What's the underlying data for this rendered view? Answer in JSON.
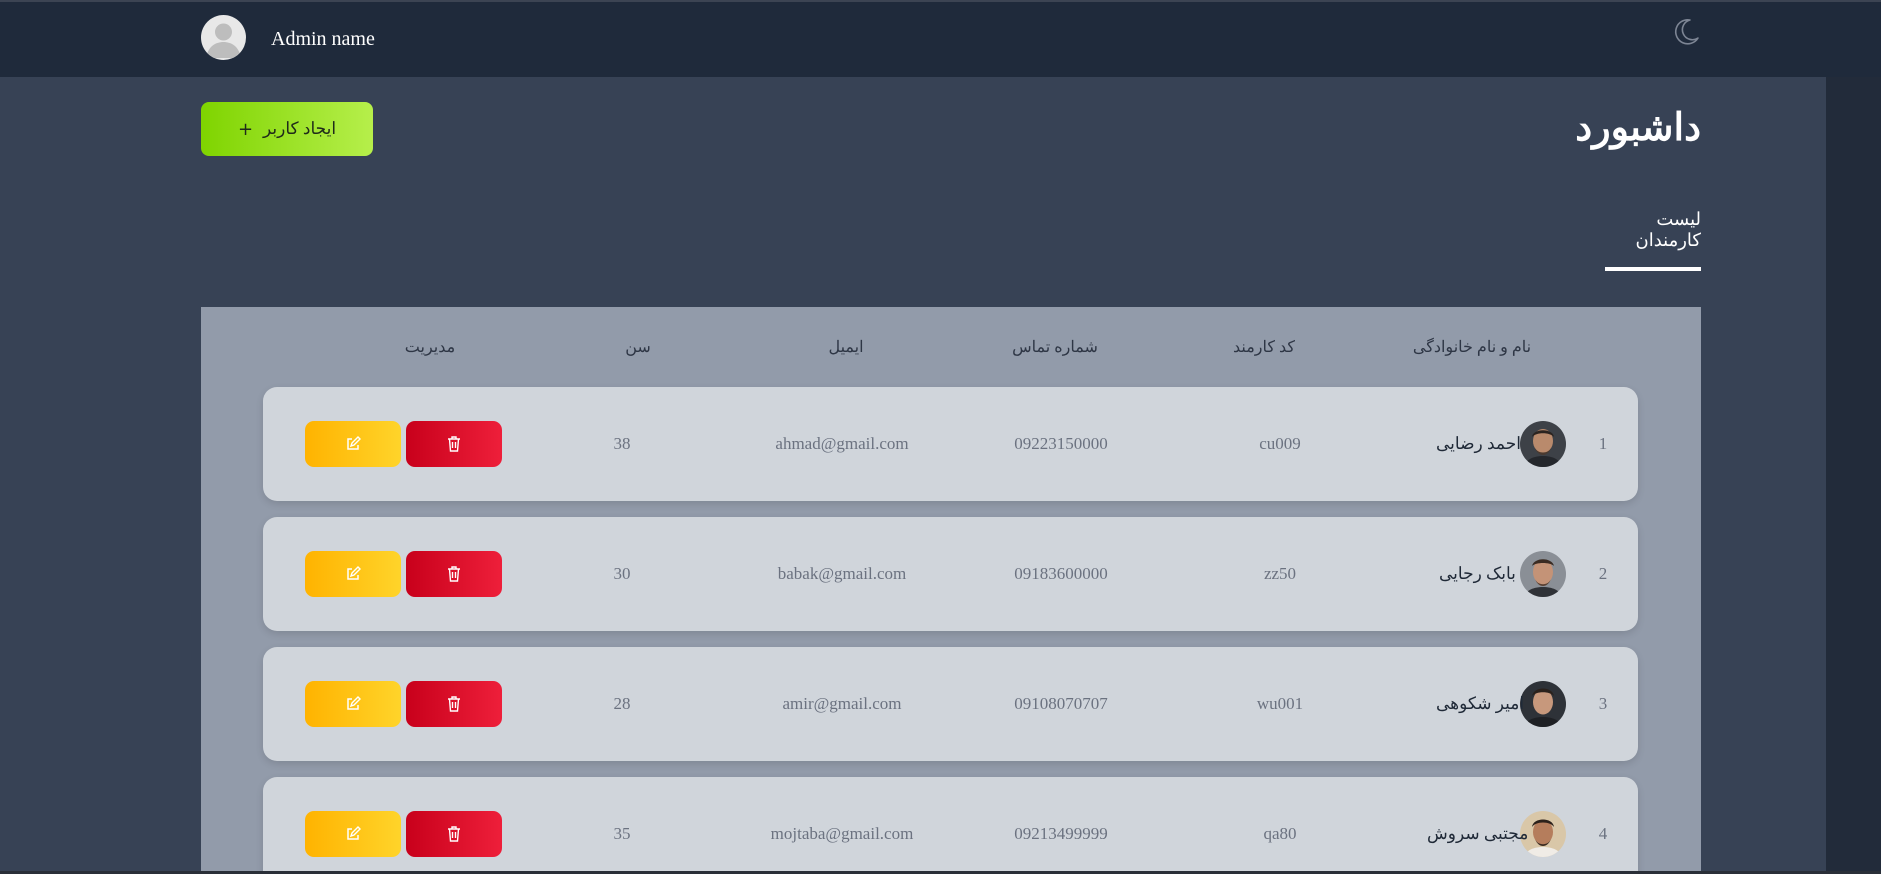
{
  "header": {
    "admin_name": "Admin name",
    "theme_toggle_icon": "moon-icon"
  },
  "page": {
    "title": "داشبورد",
    "create_button_label": "ایجاد کاربر",
    "create_button_icon": "plus-icon",
    "tab_label": "لیست کارمندان"
  },
  "table": {
    "headers": {
      "name": "نام و نام خانوادگی",
      "code": "کد کارمند",
      "phone": "شماره تماس",
      "email": "ایمیل",
      "age": "سن",
      "manage": "مدیریت"
    },
    "rows": [
      {
        "index": "1",
        "name": "احمد رضایی",
        "code": "cu009",
        "phone": "09223150000",
        "email": "ahmad@gmail.com",
        "age": "38"
      },
      {
        "index": "2",
        "name": "بابک رجایی",
        "code": "zz50",
        "phone": "09183600000",
        "email": "babak@gmail.com",
        "age": "30"
      },
      {
        "index": "3",
        "name": "امیر شکوهی",
        "code": "wu001",
        "phone": "09108070707",
        "email": "amir@gmail.com",
        "age": "28"
      },
      {
        "index": "4",
        "name": "مجتبی سروش",
        "code": "qa80",
        "phone": "09213499999",
        "email": "mojtaba@gmail.com",
        "age": "35"
      }
    ]
  },
  "colors": {
    "navbar": "#1f2a3b",
    "main_bg": "#374255",
    "table_bg": "#929baa",
    "row_bg": "#d0d5db",
    "create_button": "#8fdc1a",
    "edit_button": "#ffc107",
    "delete_button": "#dc0a25"
  }
}
